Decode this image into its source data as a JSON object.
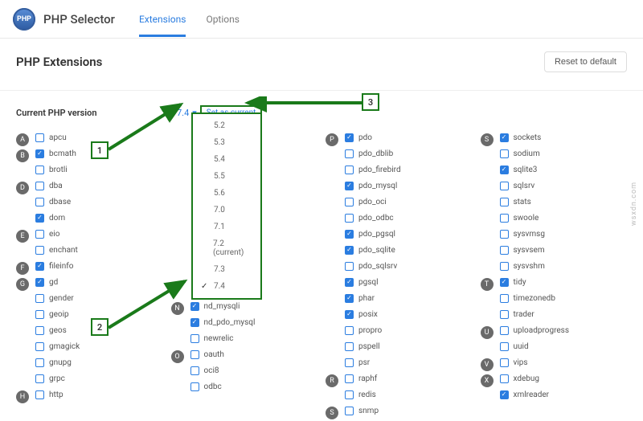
{
  "header": {
    "logo_text": "PHP",
    "app_title": "PHP Selector",
    "tabs": [
      "Extensions",
      "Options"
    ],
    "active_tab": 0
  },
  "section": {
    "title": "PHP Extensions",
    "reset_label": "Reset to default"
  },
  "version": {
    "label": "Current PHP version",
    "selected": "7.4",
    "set_current_label": "Set as current",
    "options": [
      "5.2",
      "5.3",
      "5.4",
      "5.5",
      "5.6",
      "7.0",
      "7.1",
      "7.2 (current)",
      "7.3",
      "7.4"
    ],
    "checked_option": "7.4"
  },
  "callouts": {
    "c1": "1",
    "c2": "2",
    "c3": "3"
  },
  "watermark": "wsxdn.com",
  "extensions": {
    "col1": [
      {
        "letter": "A",
        "items": [
          {
            "name": "apcu",
            "checked": false
          }
        ]
      },
      {
        "letter": "B",
        "items": [
          {
            "name": "bcmath",
            "checked": true
          },
          {
            "name": "brotli",
            "checked": false
          }
        ]
      },
      {
        "letter": "D",
        "items": [
          {
            "name": "dba",
            "checked": false
          },
          {
            "name": "dbase",
            "checked": false
          },
          {
            "name": "dom",
            "checked": true
          }
        ]
      },
      {
        "letter": "E",
        "items": [
          {
            "name": "eio",
            "checked": false
          },
          {
            "name": "enchant",
            "checked": false
          }
        ]
      },
      {
        "letter": "F",
        "items": [
          {
            "name": "fileinfo",
            "checked": true
          }
        ]
      },
      {
        "letter": "G",
        "items": [
          {
            "name": "gd",
            "checked": true
          },
          {
            "name": "gender",
            "checked": false
          },
          {
            "name": "geoip",
            "checked": false
          },
          {
            "name": "geos",
            "checked": false
          },
          {
            "name": "gmagick",
            "checked": false
          },
          {
            "name": "gnupg",
            "checked": false
          },
          {
            "name": "grpc",
            "checked": false
          }
        ]
      },
      {
        "letter": "H",
        "items": [
          {
            "name": "http",
            "checked": false
          }
        ]
      }
    ],
    "col2": [
      {
        "letter": "N",
        "items": [
          {
            "name": "nd_mysqli",
            "checked": true
          },
          {
            "name": "nd_pdo_mysql",
            "checked": true
          },
          {
            "name": "newrelic",
            "checked": false
          }
        ]
      },
      {
        "letter": "O",
        "items": [
          {
            "name": "oauth",
            "checked": false
          },
          {
            "name": "oci8",
            "checked": false
          },
          {
            "name": "odbc",
            "checked": false
          }
        ]
      }
    ],
    "col3": [
      {
        "letter": "P",
        "items": [
          {
            "name": "pdo",
            "checked": true
          },
          {
            "name": "pdo_dblib",
            "checked": false
          },
          {
            "name": "pdo_firebird",
            "checked": false
          },
          {
            "name": "pdo_mysql",
            "checked": true
          },
          {
            "name": "pdo_oci",
            "checked": false
          },
          {
            "name": "pdo_odbc",
            "checked": false
          },
          {
            "name": "pdo_pgsql",
            "checked": true
          },
          {
            "name": "pdo_sqlite",
            "checked": true
          },
          {
            "name": "pdo_sqlsrv",
            "checked": false
          },
          {
            "name": "pgsql",
            "checked": true
          },
          {
            "name": "phar",
            "checked": true
          },
          {
            "name": "posix",
            "checked": true
          },
          {
            "name": "propro",
            "checked": false
          },
          {
            "name": "pspell",
            "checked": false
          },
          {
            "name": "psr",
            "checked": false
          }
        ]
      },
      {
        "letter": "R",
        "items": [
          {
            "name": "raphf",
            "checked": false
          },
          {
            "name": "redis",
            "checked": false
          }
        ]
      },
      {
        "letter": "S",
        "items": [
          {
            "name": "snmp",
            "checked": false
          }
        ]
      }
    ],
    "col4": [
      {
        "letter": "S",
        "items": [
          {
            "name": "sockets",
            "checked": true
          },
          {
            "name": "sodium",
            "checked": false
          },
          {
            "name": "sqlite3",
            "checked": true
          },
          {
            "name": "sqlsrv",
            "checked": false
          },
          {
            "name": "stats",
            "checked": false
          },
          {
            "name": "swoole",
            "checked": false
          },
          {
            "name": "sysvmsg",
            "checked": false
          },
          {
            "name": "sysvsem",
            "checked": false
          },
          {
            "name": "sysvshm",
            "checked": false
          }
        ]
      },
      {
        "letter": "T",
        "items": [
          {
            "name": "tidy",
            "checked": true
          },
          {
            "name": "timezonedb",
            "checked": false
          },
          {
            "name": "trader",
            "checked": false
          }
        ]
      },
      {
        "letter": "U",
        "items": [
          {
            "name": "uploadprogress",
            "checked": false
          },
          {
            "name": "uuid",
            "checked": false
          }
        ]
      },
      {
        "letter": "V",
        "items": [
          {
            "name": "vips",
            "checked": false
          }
        ]
      },
      {
        "letter": "X",
        "items": [
          {
            "name": "xdebug",
            "checked": false
          },
          {
            "name": "xmlreader",
            "checked": true
          }
        ]
      }
    ]
  }
}
